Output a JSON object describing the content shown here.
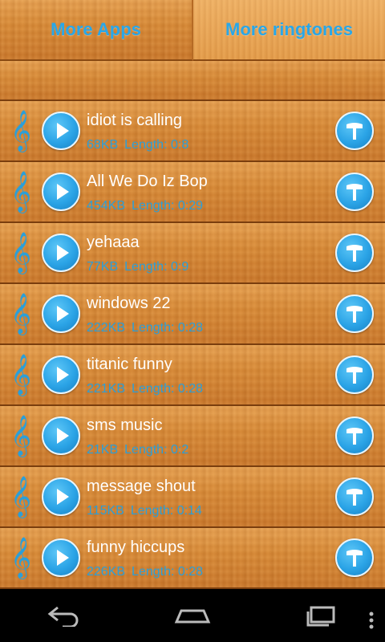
{
  "tabs": {
    "more_apps": "More Apps",
    "more_ringtones": "More ringtones"
  },
  "list": [
    {
      "title": "idiot is calling",
      "size": "68KB",
      "length": "Length: 0:8"
    },
    {
      "title": "All We Do Iz Bop",
      "size": "454KB",
      "length": "Length: 0:29"
    },
    {
      "title": "yehaaa",
      "size": "77KB",
      "length": "Length: 0:9"
    },
    {
      "title": "windows 22",
      "size": "222KB",
      "length": "Length: 0:28"
    },
    {
      "title": "titanic funny",
      "size": "221KB",
      "length": "Length: 0:28"
    },
    {
      "title": "sms music",
      "size": "21KB",
      "length": "Length: 0:2"
    },
    {
      "title": "message shout",
      "size": "115KB",
      "length": "Length: 0:14"
    },
    {
      "title": "funny hiccups",
      "size": "226KB",
      "length": "Length: 0:28"
    }
  ],
  "icons": {
    "row_leading": "treble-clef-icon",
    "play": "play-icon",
    "set_ringtone": "hammer-icon",
    "nav": [
      "back-icon",
      "home-icon",
      "recent-apps-icon",
      "overflow-menu-icon"
    ]
  },
  "colors": {
    "accent": "#2aa3e6",
    "wood": "#d88a37",
    "row_border": "#7a3e0e",
    "title_text": "#ffffff"
  }
}
